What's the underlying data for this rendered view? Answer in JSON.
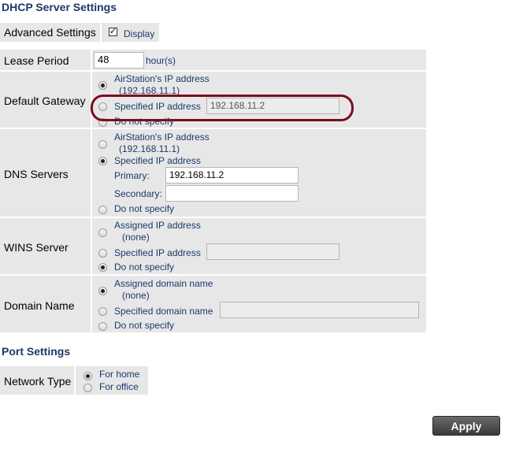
{
  "dhcp": {
    "title": "DHCP Server Settings",
    "advanced_label": "Advanced Settings",
    "display_label": "Display",
    "lease": {
      "label": "Lease Period",
      "value": "48",
      "unit": "hour(s)"
    },
    "gateway": {
      "label": "Default Gateway",
      "opt1": "AirStation's IP address",
      "opt1_sub": "(192.168.11.1)",
      "opt2": "Specified IP address",
      "opt2_value": "192.168.11.2",
      "opt3": "Do not specify"
    },
    "dns": {
      "label": "DNS Servers",
      "opt1": "AirStation's IP address",
      "opt1_sub": "(192.168.11.1)",
      "opt2": "Specified IP address",
      "primary_label": "Primary:",
      "primary_value": "192.168.11.2",
      "secondary_label": "Secondary:",
      "secondary_value": "",
      "opt3": "Do not specify"
    },
    "wins": {
      "label": "WINS Server",
      "opt1": "Assigned IP address",
      "opt1_sub": "(none)",
      "opt2": "Specified IP address",
      "opt2_value": "",
      "opt3": "Do not specify"
    },
    "domain": {
      "label": "Domain Name",
      "opt1": "Assigned domain name",
      "opt1_sub": "(none)",
      "opt2": "Specified domain name",
      "opt2_value": "",
      "opt3": "Do not specify"
    }
  },
  "port": {
    "title": "Port Settings",
    "network_label": "Network Type",
    "opt1": "For home",
    "opt2": "For office"
  },
  "apply_label": "Apply",
  "colors": {
    "section_title": "#1f3864",
    "annotation": "#7a0e1e",
    "row_bg": "#e7e7e7"
  }
}
